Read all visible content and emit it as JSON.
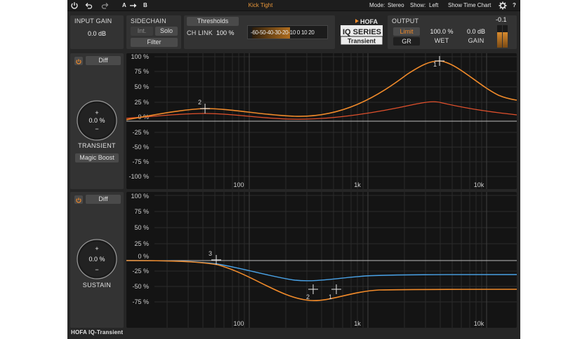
{
  "toolbar": {
    "ab_a": "A",
    "ab_b": "B",
    "preset": "Kick Tight",
    "mode_label": "Mode:",
    "mode_value": "Stereo",
    "show_label": "Show:",
    "show_value": "Left",
    "time_chart": "Show Time Chart",
    "help": "?"
  },
  "input": {
    "label": "INPUT GAIN",
    "value": "0.0 dB"
  },
  "sidechain": {
    "label": "SIDECHAIN",
    "int": "Int.",
    "solo": "Solo",
    "filter": "Filter"
  },
  "thresholds": {
    "button": "Thresholds",
    "chlink_label": "CH LINK",
    "chlink_value": "100 %",
    "meter_scale": "-60-50-40-30-20-10  0  10 20",
    "meter_level_fraction": 0.5
  },
  "logo": {
    "brand": "HOFA",
    "series": "IQ SERIES",
    "product": "Transient"
  },
  "output": {
    "label": "OUTPUT",
    "limit": "Limit",
    "gr": "GR",
    "wet_value": "100.0 %",
    "wet_label": "WET",
    "gain_value": "0.0 dB",
    "gain_label": "GAIN",
    "peak": "-0.1"
  },
  "transient": {
    "diff": "Diff",
    "knob_value": "0.0 %",
    "knob_plus": "+",
    "knob_minus": "−",
    "name": "TRANSIENT",
    "magic_boost": "Magic Boost",
    "y_labels": [
      "100 %",
      "75 %",
      "50 %",
      "25 %",
      "0 %",
      "-25 %",
      "-50 %",
      "-75 %",
      "-100 %"
    ],
    "x_labels": [
      "100",
      "1k",
      "10k"
    ],
    "node_labels": [
      "1",
      "2"
    ]
  },
  "sustain": {
    "diff": "Diff",
    "knob_value": "0.0 %",
    "knob_plus": "+",
    "knob_minus": "−",
    "name": "SUSTAIN",
    "y_labels": [
      "100 %",
      "75 %",
      "50 %",
      "25 %",
      "0 %",
      "-25 %",
      "-50 %",
      "-75 %"
    ],
    "x_labels": [
      "100",
      "1k",
      "10k"
    ],
    "node_labels": [
      "1",
      "2",
      "3"
    ]
  },
  "footer": {
    "title": "HOFA IQ-Transient"
  },
  "colors": {
    "accent_orange": "#f08a2a",
    "curve_red": "#e0502c",
    "curve_blue": "#4aa3e8",
    "plot_bg": "#141414",
    "panel_bg": "#333333"
  }
}
